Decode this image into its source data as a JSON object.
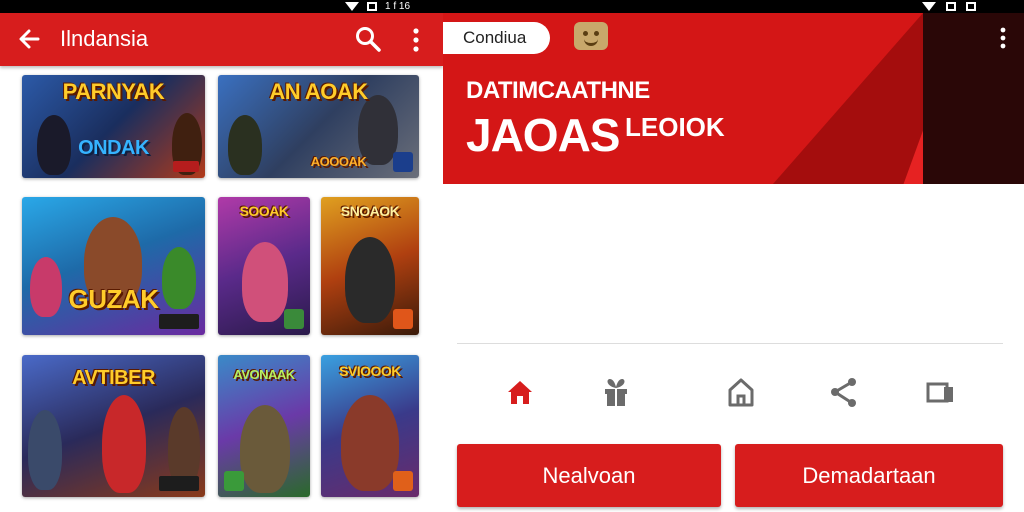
{
  "status_bar": {
    "left_text": "1 f 16",
    "right_text": ""
  },
  "app_bar": {
    "title": "Ilndansia"
  },
  "games": [
    {
      "title": "PARNYAK",
      "subtitle": "ONDAK",
      "badge": ""
    },
    {
      "title": "AN AOAK",
      "subtitle": "AOOOAK",
      "badge": ""
    },
    {
      "title": "GUZAK",
      "subtitle": "",
      "badge": ""
    },
    {
      "title": "SOOAK",
      "subtitle": "",
      "badge": ""
    },
    {
      "title": "SNOAOK",
      "subtitle": "",
      "badge": ""
    },
    {
      "title": "AVTIBER",
      "subtitle": "",
      "badge": ""
    },
    {
      "title": "AVONAAK",
      "subtitle": "",
      "badge": ""
    },
    {
      "title": "SVIOOOK",
      "subtitle": "",
      "badge": ""
    }
  ],
  "header": {
    "chip_label": "Condiua",
    "headline_1": "DATIMCAATHNE",
    "headline_2": "JAOAS",
    "headline_3": "LEOIOK"
  },
  "nav_icons": [
    "home-icon",
    "gift-icon",
    "store-icon",
    "share-icon",
    "cast-icon"
  ],
  "buttons": {
    "primary": "Nealvoan",
    "secondary": "Demadartaan"
  },
  "colors": {
    "brand_red": "#d71d1d",
    "status_black": "#000000",
    "nav_active": "#d71d1d",
    "nav_inactive": "#6b6b6b"
  }
}
